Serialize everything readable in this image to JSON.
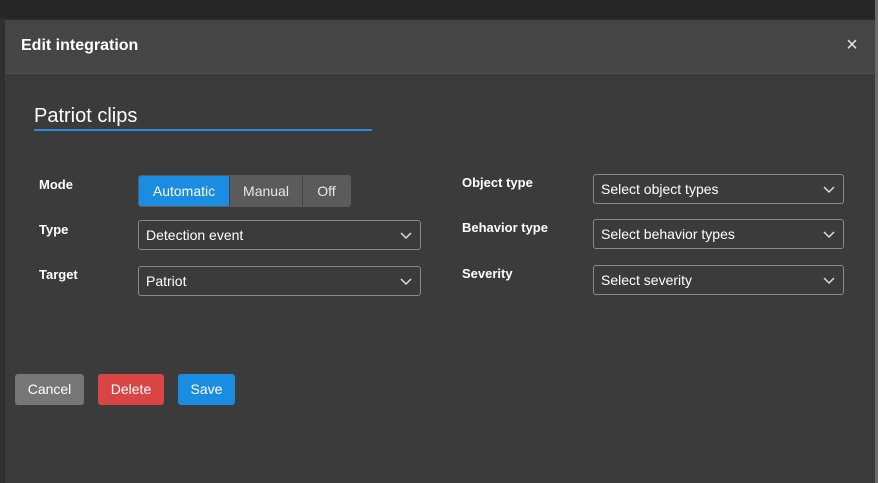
{
  "dialog": {
    "title": "Edit integration",
    "close_glyph": "×",
    "name_value": "Patriot clips"
  },
  "fields": {
    "mode_label": "Mode",
    "type_label": "Type",
    "target_label": "Target",
    "object_type_label": "Object type",
    "behavior_type_label": "Behavior type",
    "severity_label": "Severity"
  },
  "mode_options": [
    {
      "label": "Automatic",
      "active": true
    },
    {
      "label": "Manual",
      "active": false
    },
    {
      "label": "Off",
      "active": false
    }
  ],
  "selects": {
    "type_value": "Detection event",
    "target_value": "Patriot",
    "object_type_placeholder": "Select object types",
    "behavior_type_placeholder": "Select behavior types",
    "severity_placeholder": "Select severity"
  },
  "actions": {
    "cancel": "Cancel",
    "delete": "Delete",
    "save": "Save"
  },
  "colors": {
    "accent": "#1a8de2",
    "danger": "#d94545",
    "neutral_button": "#767676",
    "dialog_bg": "#3b3b3b"
  },
  "icons": {
    "close": "close-icon",
    "dropdown": "chevron-down-icon"
  }
}
